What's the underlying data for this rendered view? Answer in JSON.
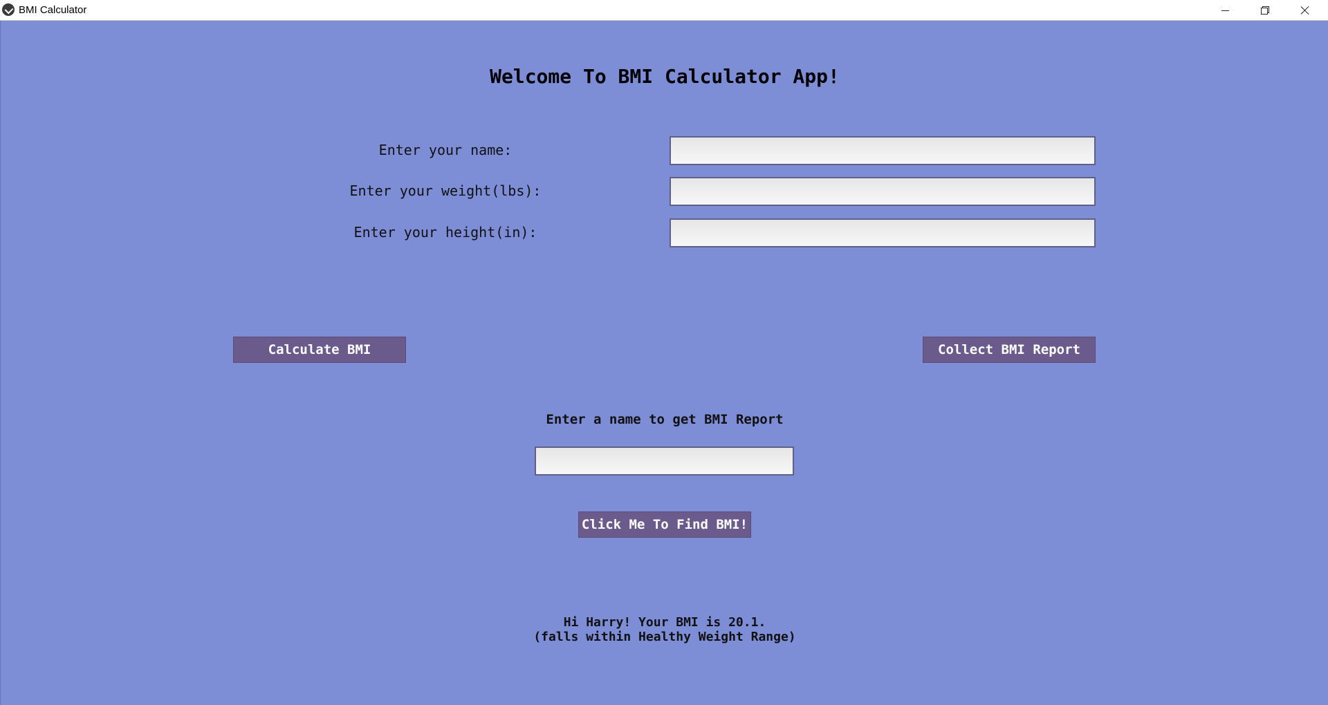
{
  "window": {
    "title": "BMI Calculator",
    "controls": {
      "minimize": "minimize",
      "maximize": "restore",
      "close": "close"
    }
  },
  "main": {
    "welcome": "Welcome To BMI Calculator App!",
    "form": {
      "name_label": "Enter your name:",
      "name_value": "",
      "weight_label": "Enter your weight(lbs):",
      "weight_value": "",
      "height_label": "Enter your height(in):",
      "height_value": ""
    },
    "calculate_button": "Calculate BMI",
    "collect_button": "Collect BMI Report",
    "report": {
      "label": "Enter a name to get BMI Report",
      "name_value": "",
      "find_button": "Click Me To Find BMI!"
    },
    "result": {
      "line1": "Hi Harry! Your BMI is 20.1.",
      "line2": "(falls within Healthy Weight Range)"
    }
  },
  "colors": {
    "background": "#7d8dd6",
    "button": "#6b5a8c",
    "button_text": "#ffffff"
  }
}
